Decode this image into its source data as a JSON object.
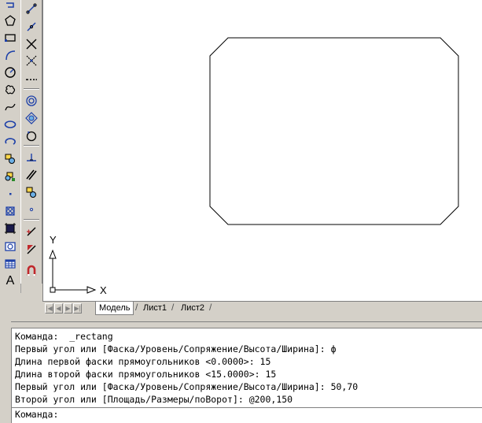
{
  "draw_toolbar": {
    "icons": [
      "polyline-icon",
      "polygon-icon",
      "rectangle-icon",
      "arc-icon",
      "circle-icon",
      "revcloud-icon",
      "spline-icon",
      "ellipse-icon",
      "ellipse-arc-icon",
      "insert-block-icon",
      "make-block-icon",
      "point-icon",
      "hatch-icon",
      "gradient-icon",
      "region-icon",
      "table-icon",
      "multiline-text-icon"
    ],
    "text_icon_glyph": "A"
  },
  "modify_toolbar": {
    "icons": [
      "erase-icon",
      "copy-icon",
      "mirror-icon",
      "offset-icon",
      "array-icon",
      "move-icon",
      "rotate-icon",
      "scale-icon",
      "stretch-icon",
      "trim-icon",
      "extend-icon",
      "break-icon",
      "fillet-icon",
      "explode-icon"
    ]
  },
  "ucs": {
    "x_label": "X",
    "y_label": "Y"
  },
  "layout_tabs": {
    "tabs": [
      "Модель",
      "Лист1",
      "Лист2"
    ],
    "active": "Модель"
  },
  "command_history": [
    "Команда:  _rectang",
    "Первый угол или [Фаска/Уровень/Сопряжение/Высота/Ширина]: ф",
    "Длина первой фаски прямоугольников <0.0000>: 15",
    "Длина второй фаски прямоугольников <15.0000>: 15",
    "Первый угол или [Фаска/Уровень/Сопряжение/Высота/Ширина]: 50,70",
    "Второй угол или [Площадь/Размеры/поВорот]: @200,150"
  ],
  "command_prompt": "Команда:",
  "colors": {
    "background": "#d4d0c8",
    "canvas": "#ffffff",
    "accent_blue": "#1c3fa8",
    "accent_red": "#c0282c"
  }
}
